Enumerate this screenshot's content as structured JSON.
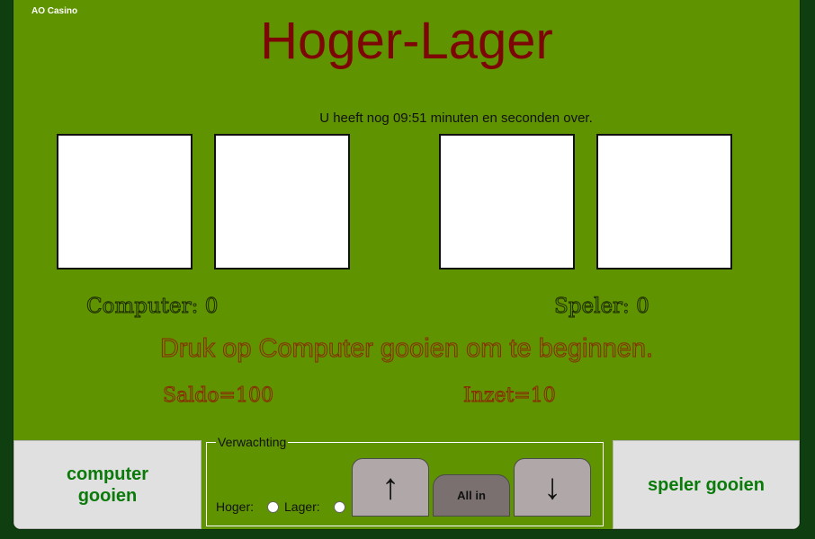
{
  "app": {
    "brand": "AO Casino",
    "title": "Hoger-Lager"
  },
  "timer": {
    "text": "U heeft nog 09:51 minuten en seconden over."
  },
  "scores": {
    "computer": "Computer: 0",
    "player": "Speler: 0"
  },
  "message": "Druk op Computer gooien om te beginnen.",
  "money": {
    "balance": "Saldo=100",
    "bet": "Inzet=10"
  },
  "controls": {
    "computer_roll": [
      "computer",
      "gooien"
    ],
    "player_roll": "speler gooien",
    "expectation_legend": "Verwachting",
    "higher_label": "Hoger:",
    "lower_label": "Lager:",
    "up_arrow": "↑",
    "all_in": "All in",
    "down_arrow": "↓"
  },
  "colors": {
    "table": "#5f9300",
    "title": "#7d0707",
    "button_text": "#0a7a0a"
  },
  "icons": {
    "up": "arrow-up-icon",
    "down": "arrow-down-icon"
  }
}
